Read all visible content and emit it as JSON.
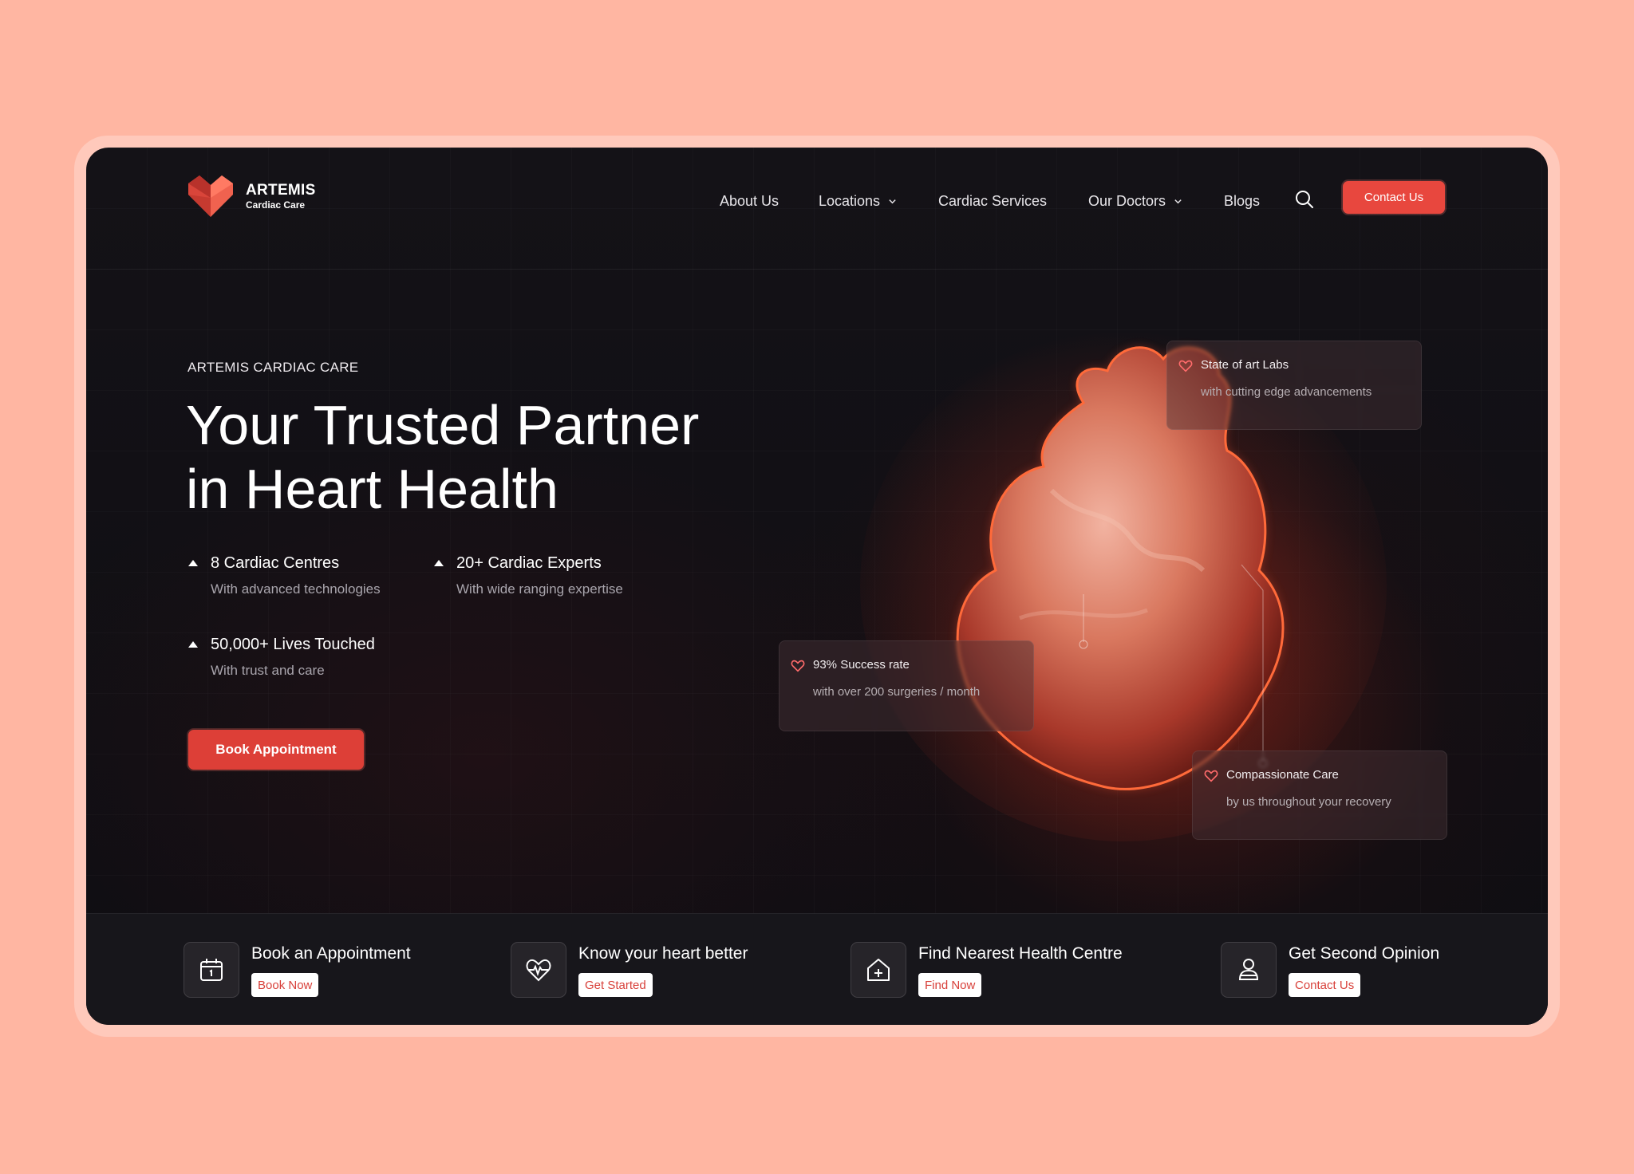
{
  "brand": {
    "name": "ARTEMIS",
    "subtitle": "Cardiac Care"
  },
  "nav": {
    "items": [
      {
        "label": "About Us",
        "has_dropdown": false
      },
      {
        "label": "Locations",
        "has_dropdown": true
      },
      {
        "label": "Cardiac Services",
        "has_dropdown": false
      },
      {
        "label": "Our Doctors",
        "has_dropdown": true
      },
      {
        "label": "Blogs",
        "has_dropdown": false
      }
    ],
    "search_icon": "search-icon",
    "contact_label": "Contact Us"
  },
  "hero": {
    "eyebrow": "ARTEMIS CARDIAC CARE",
    "headline_line1": "Your Trusted Partner",
    "headline_line2": "in Heart Health",
    "stats": [
      {
        "title": "8 Cardiac Centres",
        "subtitle": "With advanced technologies"
      },
      {
        "title": "20+ Cardiac Experts",
        "subtitle": "With wide ranging expertise"
      },
      {
        "title": "50,000+ Lives Touched",
        "subtitle": "With trust and care"
      }
    ],
    "cta_label": "Book Appointment"
  },
  "callouts": [
    {
      "title": "State of art Labs",
      "subtitle": "with cutting edge advancements"
    },
    {
      "title": "93% Success rate",
      "subtitle": "with over 200 surgeries / month"
    },
    {
      "title": "Compassionate Care",
      "subtitle": "by us throughout your recovery"
    }
  ],
  "quick_actions": [
    {
      "title": "Book an Appointment",
      "button": "Book Now",
      "icon": "calendar-icon"
    },
    {
      "title": "Know your heart better",
      "button": "Get Started",
      "icon": "heartbeat-icon"
    },
    {
      "title": "Find Nearest Health Centre",
      "button": "Find Now",
      "icon": "hospital-icon"
    },
    {
      "title": "Get Second Opinion",
      "button": "Contact Us",
      "icon": "doctor-icon"
    }
  ],
  "colors": {
    "page_bg": "#ffb6a2",
    "panel_bg": "#0f0e13",
    "accent": "#e8473e",
    "bottom_bar": "#17161b"
  }
}
